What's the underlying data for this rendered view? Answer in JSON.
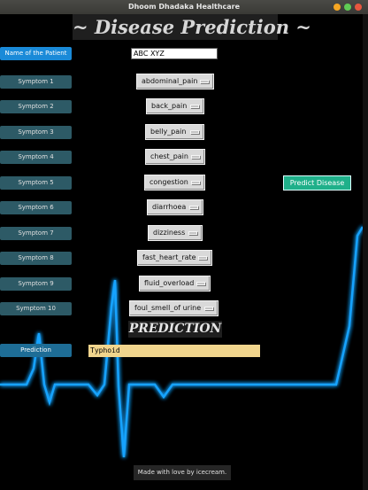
{
  "window": {
    "title": "Dhoom Dhadaka Healthcare"
  },
  "app": {
    "title": "~ Disease Prediction ~"
  },
  "patient": {
    "name_label": "Name of the Patient",
    "name_value": "ABC XYZ"
  },
  "symptoms": [
    {
      "label": "Symptom 1",
      "value": "abdominal_pain"
    },
    {
      "label": "Symptom 2",
      "value": "back_pain"
    },
    {
      "label": "Symptom 3",
      "value": "belly_pain"
    },
    {
      "label": "Symptom 4",
      "value": "chest_pain"
    },
    {
      "label": "Symptom 5",
      "value": "congestion"
    },
    {
      "label": "Symptom 6",
      "value": "diarrhoea"
    },
    {
      "label": "Symptom 7",
      "value": "dizziness"
    },
    {
      "label": "Symptom 8",
      "value": "fast_heart_rate"
    },
    {
      "label": "Symptom 9",
      "value": "fluid_overload"
    },
    {
      "label": "Symptom 10",
      "value": "foul_smell_of urine"
    }
  ],
  "actions": {
    "predict_label": "Predict Disease"
  },
  "prediction": {
    "heading": "PREDICTION",
    "label": "Prediction",
    "result": "Typhoid"
  },
  "footer": {
    "text": "Made with love by icecream."
  },
  "colors": {
    "name_label_bg": "#1a8ad8",
    "symptom_label_bg": "#2d5a66",
    "predict_button_bg": "#1fb08a",
    "result_bg": "#f1d58d",
    "ecg_glow": "#17a3ff"
  }
}
